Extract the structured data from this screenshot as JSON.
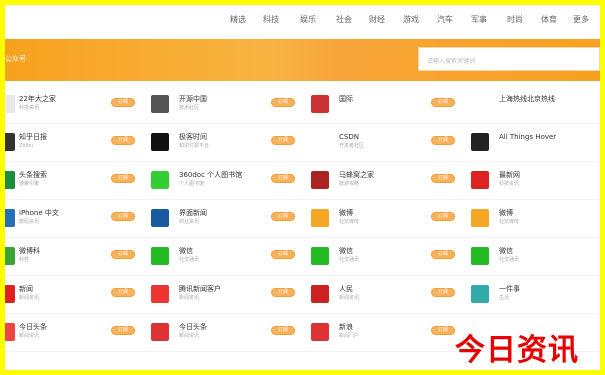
{
  "nav": {
    "items": [
      "精选",
      "科技",
      "娱乐",
      "社会",
      "财经",
      "游戏",
      "汽车",
      "军事",
      "时尚",
      "体育",
      "更多"
    ]
  },
  "banner": {
    "title": "公众号",
    "search_placeholder": "请输入搜索关键词"
  },
  "columns": [
    {
      "rows": [
        {
          "name": "22年大之家",
          "sub": "科技资讯",
          "icon": "app-icon"
        },
        {
          "name": "知乎日报",
          "sub": "Zhihu",
          "icon": "app-icon"
        },
        {
          "name": "头条搜索",
          "sub": "搜索引擎",
          "icon": "app-icon"
        },
        {
          "name": "iPhone 中文",
          "sub": "数码资讯",
          "icon": "app-icon"
        },
        {
          "name": "微博科",
          "sub": "科技",
          "icon": "app-icon"
        },
        {
          "name": "新闻",
          "sub": "新闻资讯",
          "icon": "app-icon"
        },
        {
          "name": "今日头条",
          "sub": "新闻资讯",
          "icon": "app-icon"
        }
      ]
    },
    {
      "rows": [
        {
          "name": "开源中国",
          "sub": "技术社区",
          "icon": "app-icon"
        },
        {
          "name": "极客时间",
          "sub": "知识付费平台",
          "icon": "app-icon"
        },
        {
          "name": "360doc 个人图书馆",
          "sub": "个人图书馆",
          "icon": "app-icon"
        },
        {
          "name": "界面新闻",
          "sub": "商业资讯",
          "icon": "app-icon"
        },
        {
          "name": "微信",
          "sub": "社交通讯",
          "icon": "app-icon"
        },
        {
          "name": "腾讯新闻客户",
          "sub": "新闻资讯",
          "icon": "app-icon"
        },
        {
          "name": "今日头条",
          "sub": "新闻资讯",
          "icon": "app-icon"
        }
      ]
    },
    {
      "rows": [
        {
          "name": "国际",
          "sub": "",
          "icon": "app-icon"
        },
        {
          "name": "CSDN",
          "sub": "开发者社区",
          "icon": "app-icon"
        },
        {
          "name": "马蜂窝之家",
          "sub": "旅游攻略",
          "icon": "app-icon"
        },
        {
          "name": "微博",
          "sub": "社交媒体",
          "icon": "app-icon"
        },
        {
          "name": "微信",
          "sub": "社交通讯",
          "icon": "app-icon"
        },
        {
          "name": "人民",
          "sub": "新闻资讯",
          "icon": "app-icon"
        },
        {
          "name": "新浪",
          "sub": "新闻门户",
          "icon": "app-icon"
        }
      ]
    },
    {
      "rows": [
        {
          "name": "上海热线北京热线",
          "sub": "",
          "icon": "app-icon"
        },
        {
          "name": "All Things Hover",
          "sub": "",
          "icon": "app-icon"
        },
        {
          "name": "最新网",
          "sub": "科技资讯",
          "icon": "app-icon"
        },
        {
          "name": "微博",
          "sub": "社交媒体",
          "icon": "app-icon"
        },
        {
          "name": "微信",
          "sub": "社交通讯",
          "icon": "app-icon"
        },
        {
          "name": "一件事",
          "sub": "生活",
          "icon": "app-icon"
        },
        {
          "name": "",
          "sub": "",
          "icon": "app-icon"
        }
      ]
    }
  ],
  "pill_label": "订阅",
  "watermark": "今日资讯",
  "colors": {
    "accent": "#f7a11e",
    "frame": "#ffff00",
    "watermark": "#e80000"
  }
}
